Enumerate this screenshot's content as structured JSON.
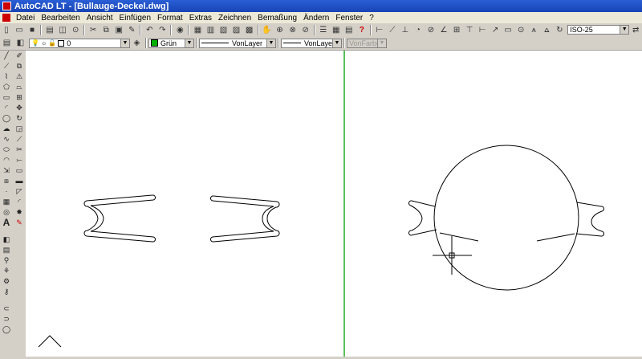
{
  "title": "AutoCAD LT - [Bullauge-Deckel.dwg]",
  "menu": [
    "Datei",
    "Bearbeiten",
    "Ansicht",
    "Einfügen",
    "Format",
    "Extras",
    "Zeichnen",
    "Bemaßung",
    "Ändern",
    "Fenster",
    "?"
  ],
  "toolbar_properties": {
    "layer_value": "0",
    "color_value": "Grün",
    "linetype_value": "VonLayer",
    "lineweight_value": "VonLayer",
    "plotstyle_value": "VonFarbe"
  },
  "dimstyle": {
    "value": "ISO-25"
  },
  "colors": {
    "titlebar": "#1f4fc6",
    "viewport_divider": "#58c058",
    "drawing_bg": "#ffffff",
    "layer_color": "#00b000"
  },
  "icons": {
    "standard": [
      "new-icon",
      "open-icon",
      "save-icon",
      "print-icon",
      "preview-icon",
      "plot-icon",
      "cut-icon",
      "copy-icon",
      "paste-icon",
      "matchprop-icon",
      "undo-icon",
      "redo-icon",
      "publish-icon",
      "pan-icon",
      "zoom-icon",
      "zoom-window-icon",
      "zoom-previous-icon",
      "properties-icon",
      "designcenter-icon",
      "toolpalette-icon",
      "help-icon"
    ],
    "dimension": [
      "dimlinear-icon",
      "dimaligned-icon",
      "dimordinate-icon",
      "dimradius-icon",
      "dimdiameter-icon",
      "dimangular-icon",
      "qdim-icon",
      "dimbaseline-icon",
      "dimcontinue-icon",
      "leader-icon",
      "tolerance-icon",
      "centermark-icon",
      "dimedit-icon",
      "dimtedit-icon",
      "dimupdate-icon"
    ],
    "draw": [
      "line-icon",
      "xline-icon",
      "pline-icon",
      "polygon-icon",
      "rectangle-icon",
      "arc-icon",
      "circle-icon",
      "revcloud-icon",
      "spline-icon",
      "ellipse-icon",
      "ellipse-arc-icon",
      "insert-icon",
      "block-icon",
      "point-icon",
      "hatch-icon",
      "region-icon",
      "text-icon"
    ],
    "modify": [
      "erase-icon",
      "copy-obj-icon",
      "mirror-icon",
      "offset-icon",
      "array-icon",
      "move-icon",
      "rotate-icon",
      "scale-icon",
      "stretch-icon",
      "trim-icon",
      "extend-icon",
      "break-icon",
      "join-icon",
      "chamfer-icon",
      "fillet-icon",
      "explode-icon"
    ]
  }
}
